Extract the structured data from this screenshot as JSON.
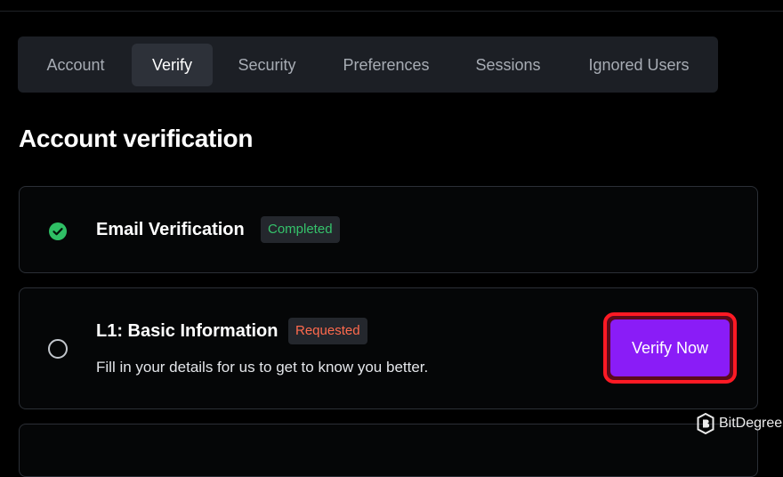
{
  "tabs": [
    {
      "label": "Account"
    },
    {
      "label": "Verify",
      "active": true
    },
    {
      "label": "Security"
    },
    {
      "label": "Preferences"
    },
    {
      "label": "Sessions"
    },
    {
      "label": "Ignored Users"
    }
  ],
  "page": {
    "title": "Account verification"
  },
  "email_card": {
    "title": "Email Verification",
    "status": "Completed",
    "icon": "check-circle-icon"
  },
  "l1_card": {
    "title": "L1: Basic Information",
    "status": "Requested",
    "description": "Fill in your details for us to get to know you better.",
    "button_label": "Verify Now",
    "icon": "radio-empty-icon"
  },
  "watermark": {
    "text": "BitDegree",
    "icon": "bitdegree-logo-icon"
  },
  "colors": {
    "accent": "#8a1cf7",
    "highlight": "#ff1a24",
    "completed": "#35c36b",
    "requested": "#ff6a4d"
  }
}
